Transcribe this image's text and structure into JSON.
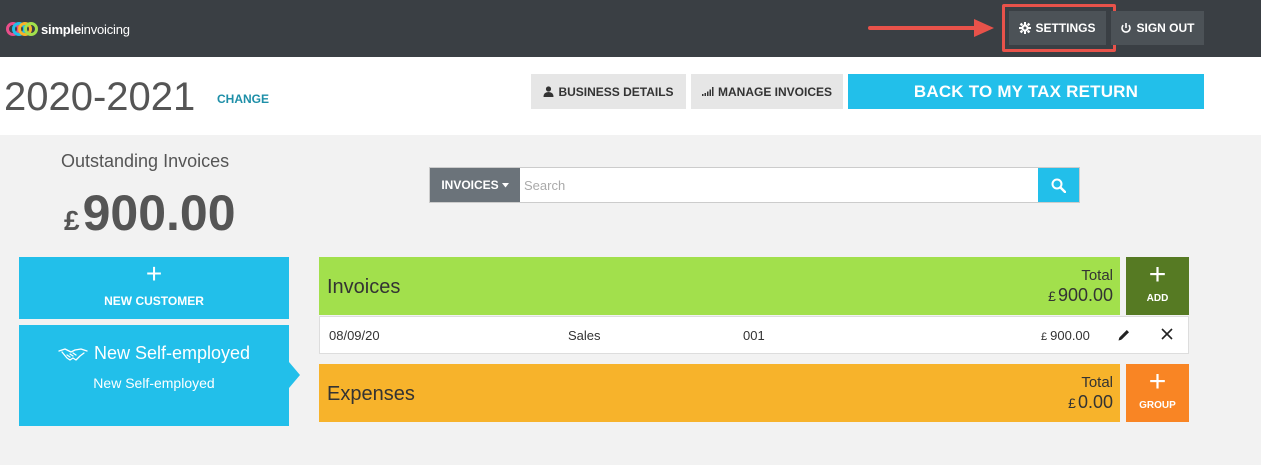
{
  "app": {
    "logo_word_bold": "simple",
    "logo_word_light": "invoicing"
  },
  "topbar": {
    "settings_label": "SETTINGS",
    "signout_label": "SIGN OUT",
    "highlight_color": "#e8524a"
  },
  "header": {
    "year": "2020-2021",
    "change_label": "CHANGE",
    "business_details_label": "BUSINESS DETAILS",
    "manage_invoices_label": "MANAGE INVOICES",
    "back_label": "BACK TO MY TAX RETURN"
  },
  "summary": {
    "outstanding_label": "Outstanding Invoices",
    "currency": "£",
    "outstanding_amount": "900.00"
  },
  "sidebar": {
    "new_customer_label": "NEW CUSTOMER",
    "selected_customer_title": "New Self-employed",
    "selected_customer_subtitle": "New Self-employed"
  },
  "search": {
    "type_label": "INVOICES",
    "placeholder": "Search",
    "value": ""
  },
  "invoices": {
    "title": "Invoices",
    "total_label": "Total",
    "total_currency": "£",
    "total_amount": "900.00",
    "add_label": "ADD",
    "rows": [
      {
        "date": "08/09/20",
        "type": "Sales",
        "number": "001",
        "currency": "£",
        "amount": "900.00"
      }
    ]
  },
  "expenses": {
    "title": "Expenses",
    "total_label": "Total",
    "total_currency": "£",
    "total_amount": "0.00",
    "group_label": "GROUP"
  },
  "colors": {
    "topbar": "#3a3f44",
    "accent_blue": "#22bfea",
    "invoices_green": "#a2e04c",
    "add_green": "#567a23",
    "expenses_orange": "#f7b32b",
    "group_orange": "#f98524"
  }
}
